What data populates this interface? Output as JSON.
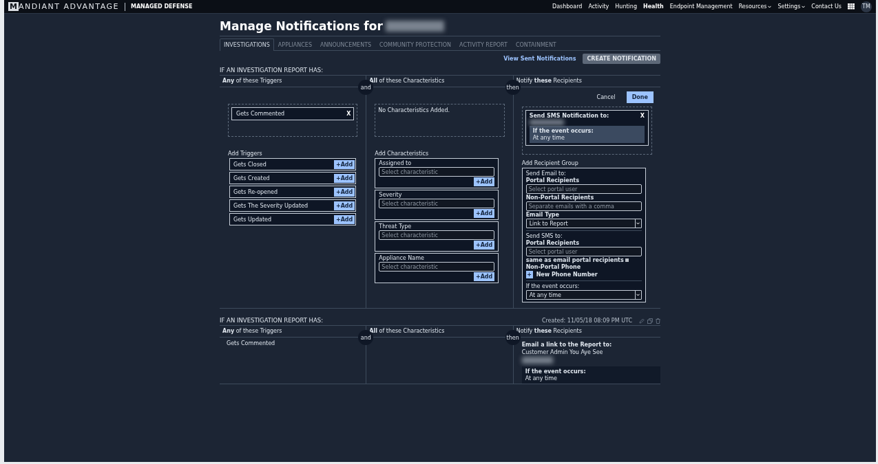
{
  "topbar": {
    "logo_letter": "M",
    "brand": "ANDIANT ADVANTAGE",
    "product": "MANAGED DEFENSE",
    "nav": [
      {
        "label": "Dashboard",
        "selected": false,
        "dropdown": false
      },
      {
        "label": "Activity",
        "selected": false,
        "dropdown": false
      },
      {
        "label": "Hunting",
        "selected": false,
        "dropdown": false
      },
      {
        "label": "Health",
        "selected": true,
        "dropdown": false
      },
      {
        "label": "Endpoint Management",
        "selected": false,
        "dropdown": false
      },
      {
        "label": "Resources",
        "selected": false,
        "dropdown": true
      },
      {
        "label": "Settings",
        "selected": false,
        "dropdown": true
      },
      {
        "label": "Contact Us",
        "selected": false,
        "dropdown": false
      }
    ],
    "user": "TM"
  },
  "title": "Manage Notifications for",
  "tabs": [
    {
      "label": "INVESTIGATIONS",
      "selected": true
    },
    {
      "label": "APPLIANCES",
      "selected": false
    },
    {
      "label": "ANNOUNCEMENTS",
      "selected": false
    },
    {
      "label": "COMMUNITY PROTECTION",
      "selected": false
    },
    {
      "label": "ACTIVITY REPORT",
      "selected": false
    },
    {
      "label": "CONTAINMENT",
      "selected": false
    }
  ],
  "actions": {
    "view_sent": "View Sent Notifications",
    "create": "CREATE NOTIFICATION",
    "create_disabled": true
  },
  "editor": {
    "heading": "IF AN INVESTIGATION REPORT HAS:",
    "columns": [
      "**Any** of these Triggers",
      "**All** of these Characteristics",
      "Notify **these** Recipients"
    ],
    "connectors": [
      "and",
      "then"
    ],
    "cancel": "Cancel",
    "done": "Done",
    "active_triggers": [
      {
        "label": "Gets Commented",
        "remove": "X"
      }
    ],
    "no_characteristics": "No Characteristics Added.",
    "active_recipient": {
      "title": "Send SMS Notification to:",
      "remove": "X",
      "condition_label": "If the event occurs:",
      "condition_value": "At any time"
    },
    "add_triggers": {
      "title": "Add Triggers",
      "items": [
        {
          "label": "Gets Closed",
          "add": "+Add"
        },
        {
          "label": "Gets Created",
          "add": "+Add"
        },
        {
          "label": "Gets Re-opened",
          "add": "+Add"
        },
        {
          "label": "Gets The Severity Updated",
          "add": "+Add"
        },
        {
          "label": "Gets Updated",
          "add": "+Add"
        }
      ]
    },
    "add_characteristics": {
      "title": "Add Characteristics",
      "items": [
        {
          "label": "Assigned to",
          "placeholder": "Select characteristic",
          "add": "+Add"
        },
        {
          "label": "Severity",
          "placeholder": "Select characteristic",
          "add": "+Add"
        },
        {
          "label": "Threat Type",
          "placeholder": "Select characteristic",
          "add": "+Add"
        },
        {
          "label": "Appliance Name",
          "placeholder": "Select characteristic",
          "add": "+Add"
        }
      ]
    },
    "add_recipient": {
      "title": "Add Recipient Group",
      "email_title": "Send Email to:",
      "portal_label": "Portal Recipients",
      "portal_placeholder": "Select portal user",
      "nonportal_label": "Non-Portal Recipients",
      "nonportal_placeholder": "Separate emails with a comma",
      "email_type_label": "Email Type",
      "email_type_value": "Link to Report",
      "sms_title": "Send SMS to:",
      "sms_portal_label": "Portal Recipients",
      "sms_portal_placeholder": "Select portal user",
      "same_as_email": {
        "label": "same as email portal recipients",
        "checked": false
      },
      "phone_label": "Non-Portal Phone",
      "phone_add": "+",
      "phone_add_label": "New Phone Number",
      "event_label": "If the event occurs:",
      "event_value": "At any time"
    }
  },
  "saved": {
    "heading": "IF AN INVESTIGATION REPORT HAS:",
    "created": "Created: 11/05/18 08:09 PM UTC",
    "columns": [
      "**Any** of these Triggers",
      "**All** of these Characteristics",
      "Notify **these** Recipients"
    ],
    "connectors": [
      "and",
      "then"
    ],
    "triggers": [
      "Gets Commented"
    ],
    "recipient_title": "Email a link to the Report to:",
    "recipient_name": "Customer Admin You Aye See",
    "condition_label": "If the event occurs:",
    "condition_value": "At any time"
  }
}
